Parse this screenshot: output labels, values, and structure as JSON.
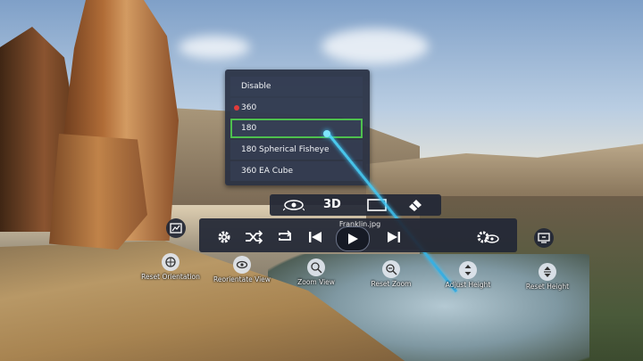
{
  "projection_menu": {
    "items": [
      {
        "label": "Disable",
        "selected": false,
        "hover": false
      },
      {
        "label": "360",
        "selected": true,
        "hover": false
      },
      {
        "label": "180",
        "selected": false,
        "hover": true
      },
      {
        "label": "180 Spherical Fisheye",
        "selected": false,
        "hover": false
      },
      {
        "label": "360 EA Cube",
        "selected": false,
        "hover": false
      }
    ]
  },
  "mode_bar": {
    "stereo_label": "3D",
    "icons": [
      "view-mode-eye-icon",
      "screen-frame-icon",
      "diamond-cursor-icon"
    ]
  },
  "player": {
    "filename": "Franklin.jpg",
    "buttons": [
      "settings-gear-icon",
      "shuffle-icon",
      "repeat-icon",
      "previous-icon",
      "play-icon",
      "next-icon",
      "view-settings-icon"
    ]
  },
  "actions": [
    {
      "label": "Reset Orientation",
      "icon": "reset-orientation-icon"
    },
    {
      "label": "Reorientate View",
      "icon": "reorientate-view-icon"
    },
    {
      "label": "Zoom View",
      "icon": "zoom-view-icon"
    },
    {
      "label": "Reset Zoom",
      "icon": "reset-zoom-icon"
    },
    {
      "label": "Adjust Height",
      "icon": "adjust-height-icon"
    },
    {
      "label": "Reset Height",
      "icon": "reset-height-icon"
    }
  ],
  "colors": {
    "panel": "#222836",
    "selection_outline": "#4ec04e",
    "radio_selected": "#e23b3b",
    "laser": "#3cc8ff"
  }
}
